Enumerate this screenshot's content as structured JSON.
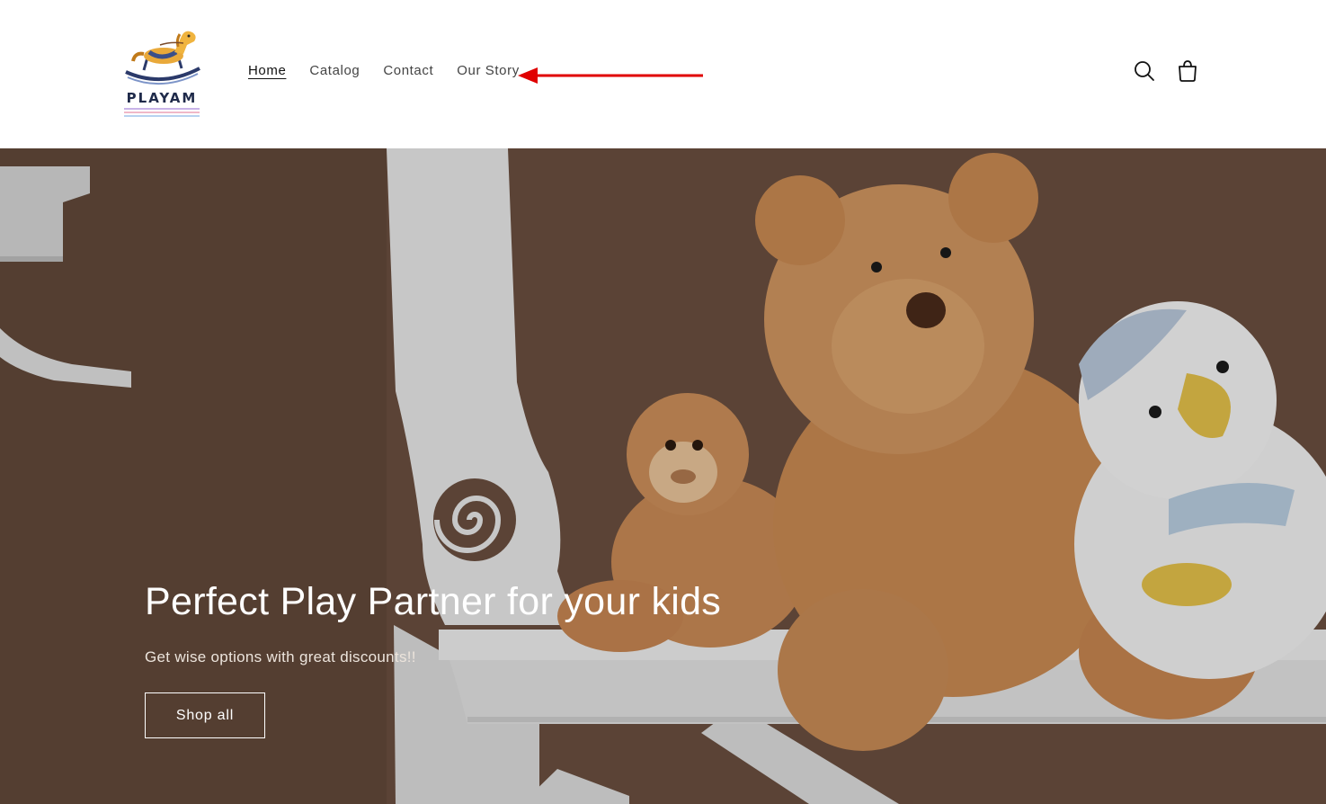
{
  "brand": {
    "name": "PLAYAM"
  },
  "nav": {
    "items": [
      {
        "label": "Home",
        "active": true
      },
      {
        "label": "Catalog",
        "active": false
      },
      {
        "label": "Contact",
        "active": false
      },
      {
        "label": "Our Story",
        "active": false
      }
    ]
  },
  "header_icons": {
    "search": "search-icon",
    "cart": "cart-icon"
  },
  "annotation": {
    "icon": "red-arrow-icon",
    "color": "#e00000",
    "points_to": "Our Story"
  },
  "hero": {
    "title": "Perfect Play Partner for your kids",
    "subtitle": "Get wise options with great discounts!!",
    "button_label": "Shop all"
  },
  "colors": {
    "hero_background": "#6b5040",
    "nav_text": "#444444",
    "accent": "#e00000"
  }
}
